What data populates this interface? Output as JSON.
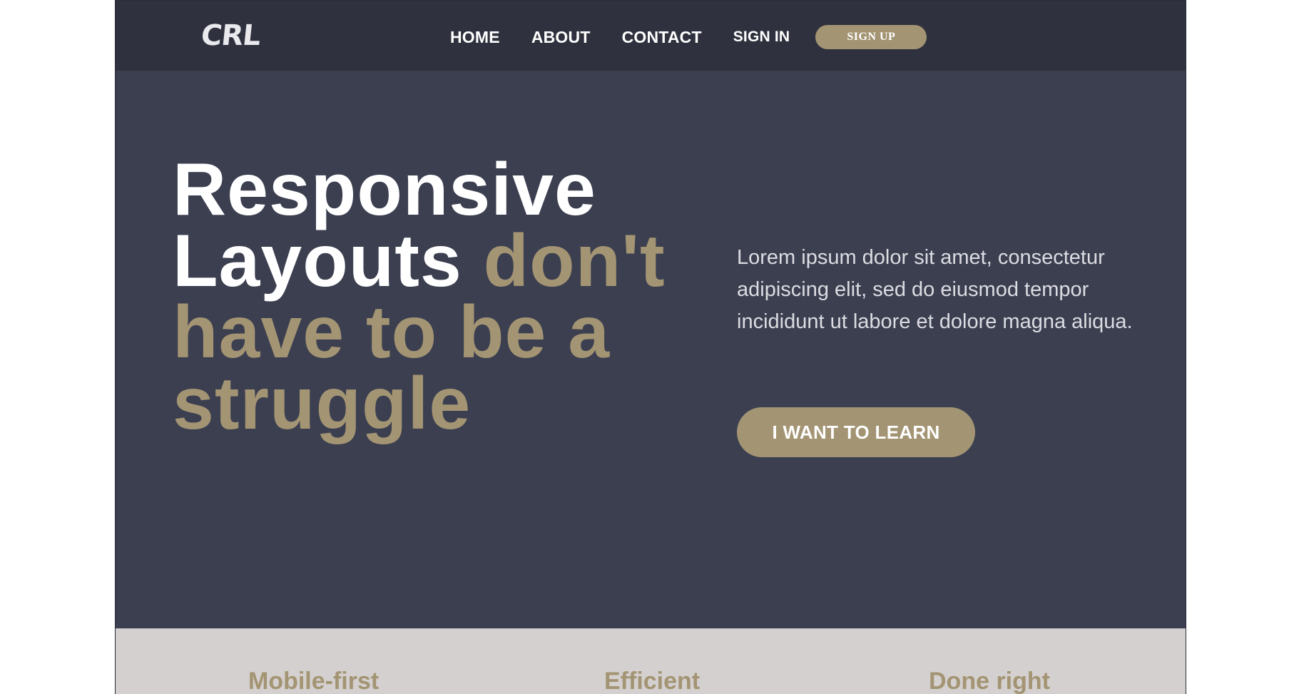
{
  "header": {
    "logo": "CRL",
    "nav": [
      {
        "label": "HOME"
      },
      {
        "label": "ABOUT"
      },
      {
        "label": "CONTACT"
      }
    ],
    "signin_label": "SIGN IN",
    "signup_label": "SIGN UP"
  },
  "hero": {
    "title_white": "Responsive Layouts",
    "title_accent": "don't have to be a struggle",
    "body": "Lorem ipsum dolor sit amet, consectetur adipiscing elit, sed do eiusmod tempor incididunt ut labore et dolore magna aliqua.",
    "cta_label": "I WANT TO LEARN"
  },
  "features": [
    {
      "title": "Mobile-first"
    },
    {
      "title": "Efficient"
    },
    {
      "title": "Done right"
    }
  ],
  "colors": {
    "header_bg": "#2f323e",
    "hero_bg": "#3b3f50",
    "accent": "#a39473",
    "features_bg": "#d4d0cf"
  }
}
